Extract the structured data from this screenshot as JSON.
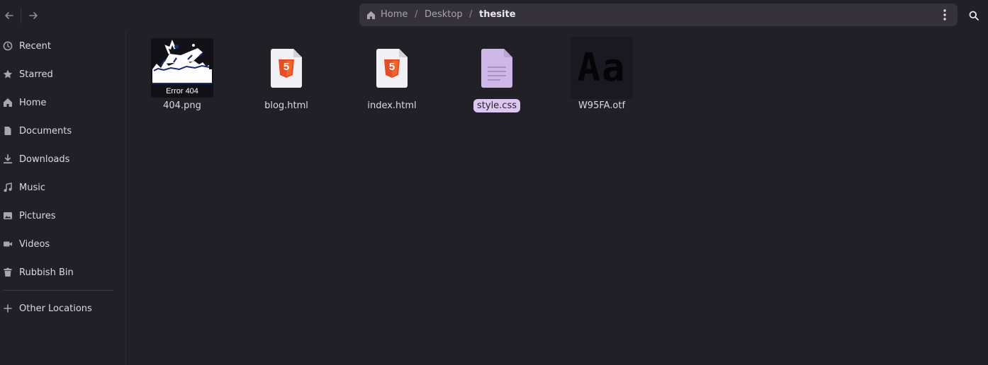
{
  "header": {
    "back_icon": "arrow-left-icon",
    "forward_icon": "arrow-right-icon",
    "breadcrumb": [
      {
        "label": "Home",
        "icon": "home-icon"
      },
      {
        "label": "Desktop"
      },
      {
        "label": "thesite"
      }
    ],
    "separator": "/",
    "menu_icon": "kebab-menu-icon",
    "search_icon": "search-icon"
  },
  "sidebar": {
    "items": [
      {
        "label": "Recent",
        "icon": "clock-icon"
      },
      {
        "label": "Starred",
        "icon": "star-icon"
      },
      {
        "label": "Home",
        "icon": "home-icon"
      },
      {
        "label": "Documents",
        "icon": "document-icon"
      },
      {
        "label": "Downloads",
        "icon": "download-icon"
      },
      {
        "label": "Music",
        "icon": "music-icon"
      },
      {
        "label": "Pictures",
        "icon": "picture-icon"
      },
      {
        "label": "Videos",
        "icon": "video-icon"
      },
      {
        "label": "Rubbish Bin",
        "icon": "trash-icon"
      }
    ],
    "other": {
      "label": "Other Locations",
      "icon": "plus-icon"
    }
  },
  "files": [
    {
      "name": "404.png",
      "icon": "image-thumbnail-icon",
      "thumb_caption": "Error 404"
    },
    {
      "name": "blog.html",
      "icon": "html5-file-icon",
      "badge": "5"
    },
    {
      "name": "index.html",
      "icon": "html5-file-icon",
      "badge": "5"
    },
    {
      "name": "style.css",
      "icon": "css-file-icon",
      "selected": true
    },
    {
      "name": "W95FA.otf",
      "icon": "font-file-icon",
      "preview": "Aa"
    }
  ],
  "colors": {
    "background": "#222027",
    "pathbar": "#35323c",
    "selection": "#ddc7f2",
    "html5_orange": "#e44d26"
  }
}
